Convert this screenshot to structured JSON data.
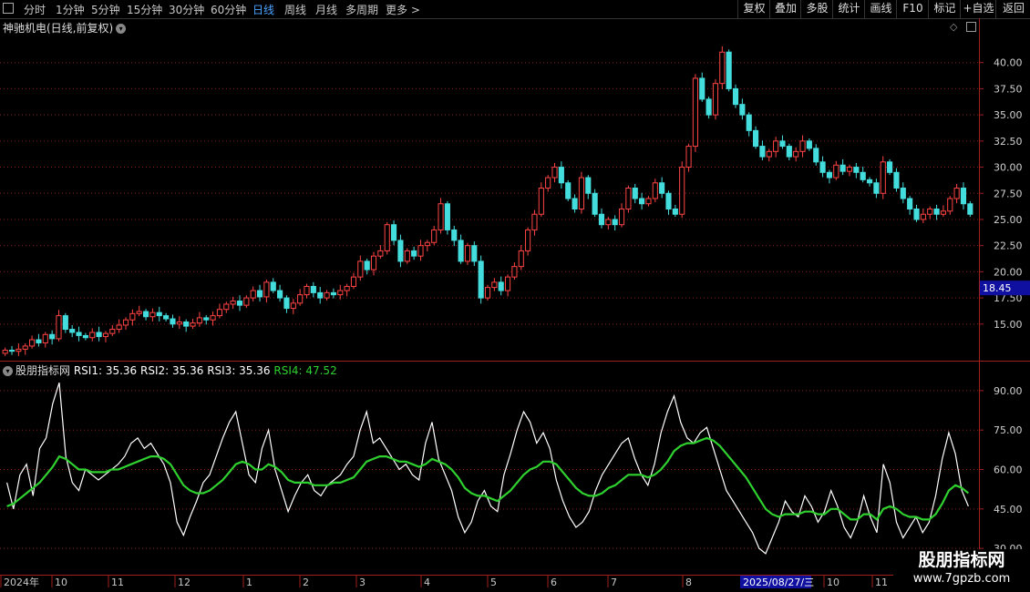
{
  "toolbar": {
    "periods": [
      "分时",
      "1分钟",
      "5分钟",
      "15分钟",
      "30分钟",
      "60分钟",
      "日线",
      "周线",
      "月线",
      "多周期",
      "更多 >"
    ],
    "active_period": "日线",
    "actions": [
      "复权",
      "叠加",
      "多股",
      "统计",
      "画线",
      "F10",
      "标记",
      "+自选",
      "返回"
    ]
  },
  "stock": {
    "title": "神驰机电(日线,前复权)"
  },
  "price_axis": {
    "ticks": [
      "40.00",
      "37.50",
      "35.00",
      "32.50",
      "30.00",
      "27.50",
      "25.00",
      "22.50",
      "20.00",
      "17.50",
      "15.00"
    ],
    "current_price": "18.45"
  },
  "rsi": {
    "indicator_name": "股朋指标网",
    "rsi1": "RSI1: 35.36",
    "rsi2": "RSI2: 35.36",
    "rsi3": "RSI3: 35.36",
    "rsi4": "RSI4: 47.52",
    "ticks": [
      "90.00",
      "75.00",
      "60.00",
      "45.00",
      "30.00"
    ]
  },
  "time_axis": {
    "labels": [
      "2024年",
      "10",
      "11",
      "12",
      "1",
      "2",
      "3",
      "4",
      "5",
      "6",
      "7",
      "8",
      "9",
      "10",
      "11"
    ],
    "cursor_date": "2025/08/27/三"
  },
  "watermark": {
    "title": "股朋指标网",
    "url": "www.7gpzb.com"
  },
  "colors": {
    "up": "#ff4444",
    "down": "#44dddd",
    "rsi_white": "#ffffff",
    "rsi_green": "#2fd12f",
    "grid": "#8b1a1a"
  },
  "chart_data": [
    {
      "type": "candlestick",
      "title": "神驰机电(日线,前复权)",
      "ylim": [
        11.5,
        42.5
      ],
      "closes": [
        12.5,
        12.4,
        12.6,
        12.9,
        13.5,
        13.2,
        14.0,
        13.6,
        15.8,
        14.5,
        14.2,
        13.9,
        13.7,
        14.2,
        13.8,
        14.1,
        14.5,
        14.9,
        15.4,
        16.0,
        16.2,
        15.7,
        16.1,
        15.8,
        15.5,
        15.0,
        15.2,
        14.8,
        15.1,
        15.6,
        15.4,
        15.8,
        16.4,
        16.9,
        17.2,
        16.8,
        17.5,
        18.2,
        17.6,
        19.0,
        18.2,
        17.5,
        16.5,
        17.0,
        17.8,
        18.6,
        18.0,
        17.5,
        18.0,
        17.8,
        18.2,
        18.6,
        19.5,
        21.0,
        20.2,
        21.5,
        22.0,
        24.5,
        23.0,
        21.0,
        22.0,
        21.5,
        22.5,
        22.8,
        24.0,
        26.5,
        24.0,
        23.0,
        21.0,
        22.5,
        21.0,
        17.5,
        18.5,
        19.0,
        18.2,
        19.5,
        20.5,
        22.0,
        24.0,
        25.5,
        28.0,
        29.0,
        30.0,
        28.5,
        27.0,
        26.0,
        29.0,
        27.5,
        25.5,
        24.5,
        25.0,
        24.5,
        26.0,
        28.0,
        27.0,
        26.5,
        27.0,
        28.5,
        27.5,
        26.0,
        25.5,
        30.0,
        32.0,
        38.5,
        36.5,
        35.0,
        38.0,
        41.0,
        37.5,
        36.0,
        35.0,
        33.5,
        32.0,
        31.0,
        31.5,
        32.5,
        32.0,
        31.0,
        31.5,
        32.5,
        31.8,
        30.5,
        29.5,
        29.0,
        30.2,
        29.6,
        30.0,
        29.5,
        28.8,
        28.5,
        27.5,
        30.5,
        29.5,
        28.0,
        27.0,
        26.0,
        25.0,
        25.5,
        26.0,
        25.5,
        25.8,
        27.0,
        28.0,
        26.5,
        25.5
      ]
    },
    {
      "type": "line",
      "title": "RSI",
      "ylim": [
        20,
        100
      ],
      "series": [
        {
          "name": "RSI1",
          "values": [
            55,
            45,
            58,
            62,
            50,
            68,
            72,
            85,
            93,
            65,
            55,
            52,
            60,
            58,
            56,
            58,
            60,
            62,
            65,
            70,
            72,
            68,
            70,
            66,
            62,
            55,
            40,
            35,
            42,
            48,
            55,
            58,
            65,
            72,
            78,
            82,
            70,
            58,
            55,
            68,
            75,
            60,
            52,
            44,
            50,
            55,
            58,
            52,
            50,
            54,
            56,
            58,
            62,
            65,
            75,
            82,
            70,
            72,
            68,
            64,
            60,
            62,
            58,
            56,
            70,
            78,
            64,
            58,
            52,
            42,
            36,
            40,
            48,
            52,
            46,
            44,
            58,
            66,
            75,
            82,
            78,
            70,
            74,
            68,
            56,
            48,
            42,
            38,
            40,
            44,
            52,
            58,
            62,
            66,
            70,
            72,
            64,
            58,
            54,
            62,
            74,
            82,
            88,
            78,
            72,
            70,
            74,
            76,
            68,
            60,
            52,
            48,
            44,
            40,
            36,
            30,
            28,
            34,
            40,
            48,
            44,
            42,
            50,
            46,
            40,
            44,
            52,
            46,
            38,
            34,
            40,
            50,
            42,
            36,
            62,
            55,
            40,
            34,
            38,
            42,
            36,
            40,
            50,
            64,
            74,
            66,
            52,
            46
          ]
        },
        {
          "name": "RSI4",
          "values": [
            46,
            47,
            49,
            51,
            53,
            55,
            58,
            61,
            65,
            64,
            62,
            60,
            60,
            59,
            59,
            59,
            60,
            60,
            61,
            62,
            63,
            64,
            65,
            65,
            64,
            62,
            58,
            54,
            52,
            51,
            51,
            52,
            54,
            56,
            59,
            62,
            63,
            62,
            60,
            60,
            62,
            61,
            59,
            56,
            55,
            55,
            55,
            54,
            54,
            54,
            55,
            55,
            56,
            57,
            60,
            63,
            64,
            65,
            65,
            64,
            63,
            63,
            62,
            61,
            62,
            64,
            63,
            62,
            60,
            57,
            53,
            51,
            50,
            50,
            49,
            48,
            50,
            52,
            55,
            58,
            60,
            61,
            63,
            63,
            62,
            59,
            56,
            53,
            51,
            50,
            50,
            51,
            53,
            54,
            56,
            58,
            58,
            58,
            57,
            58,
            60,
            63,
            67,
            69,
            70,
            70,
            71,
            72,
            71,
            69,
            66,
            63,
            60,
            57,
            53,
            49,
            45,
            43,
            42,
            43,
            43,
            43,
            44,
            44,
            43,
            43,
            45,
            45,
            43,
            41,
            41,
            43,
            43,
            41,
            45,
            46,
            45,
            43,
            42,
            42,
            41,
            41,
            43,
            47,
            52,
            54,
            53,
            51
          ]
        }
      ]
    }
  ]
}
